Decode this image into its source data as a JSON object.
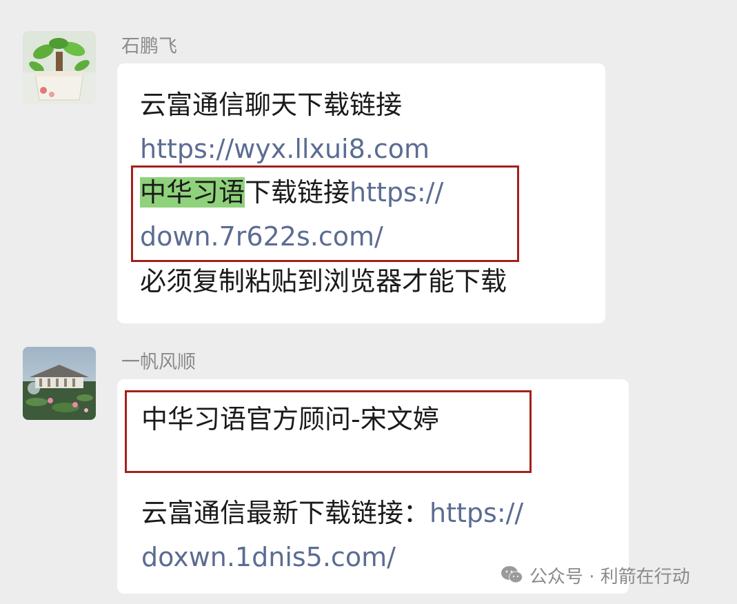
{
  "messages": [
    {
      "sender": "石鹏飞",
      "avatar_icon": "potted-plant-avatar",
      "lines": {
        "l1": "云富通信聊天下载链接",
        "l2_link": "https://wyx.llxui8.com",
        "l3_highlight": "中华习语",
        "l3_text": "下载链接",
        "l3_link": "https://",
        "l4_link": "down.7r622s.com/",
        "l5": "必须复制粘贴到浏览器才能下载"
      }
    },
    {
      "sender": "一帆风顺",
      "avatar_icon": "pavilion-lotus-pond-avatar",
      "lines": {
        "l1": "中华习语官方顾问-宋文婷",
        "l2_text": "云富通信最新下载链接：",
        "l2_link": "https://",
        "l3_link": "doxwn.1dnis5.com/"
      }
    }
  ],
  "watermark": {
    "icon": "wechat-icon",
    "text": "公众号 · 利箭在行动"
  },
  "colors": {
    "background": "#ededed",
    "bubble": "#ffffff",
    "link": "#5b6c92",
    "highlight": "#8fd27b",
    "annotation_box": "#a3201a"
  }
}
